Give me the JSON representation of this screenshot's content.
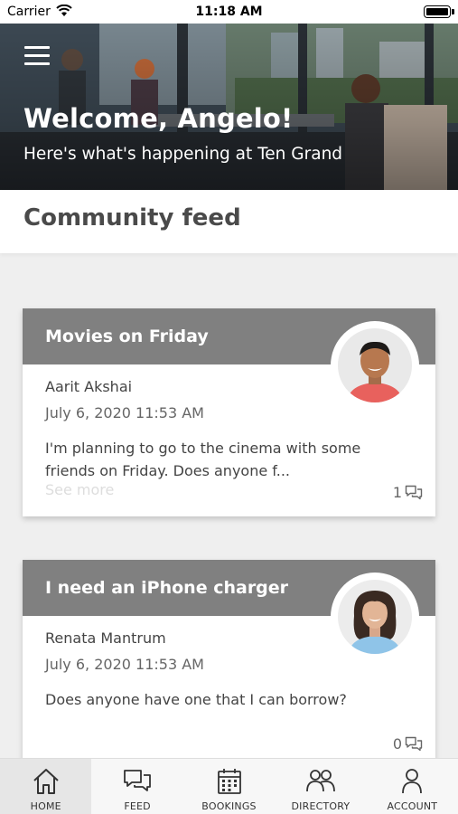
{
  "status_bar": {
    "carrier": "Carrier",
    "time": "11:18 AM"
  },
  "hero": {
    "title": "Welcome, Angelo!",
    "subtitle": "Here's what's happening at Ten Grand"
  },
  "feed": {
    "title": "Community feed",
    "posts": [
      {
        "title": "Movies on Friday",
        "author": "Aarit Akshai",
        "date": "July 6, 2020 11:53 AM",
        "body": "I'm planning to go to the cinema with some friends on Friday. Does anyone f...",
        "see_more": "See more",
        "comments": "1"
      },
      {
        "title": "I need an iPhone charger",
        "author": "Renata Mantrum",
        "date": "July 6, 2020 11:53 AM",
        "body": "Does anyone have one that I can borrow?",
        "comments": "0"
      }
    ]
  },
  "tabs": [
    {
      "label": "HOME",
      "icon": "home-icon",
      "active": true
    },
    {
      "label": "FEED",
      "icon": "feed-icon"
    },
    {
      "label": "BOOKINGS",
      "icon": "calendar-icon"
    },
    {
      "label": "DIRECTORY",
      "icon": "people-icon"
    },
    {
      "label": "ACCOUNT",
      "icon": "person-icon"
    }
  ],
  "colors": {
    "card_header": "#808080",
    "active_tab": "#e6e6e6"
  }
}
